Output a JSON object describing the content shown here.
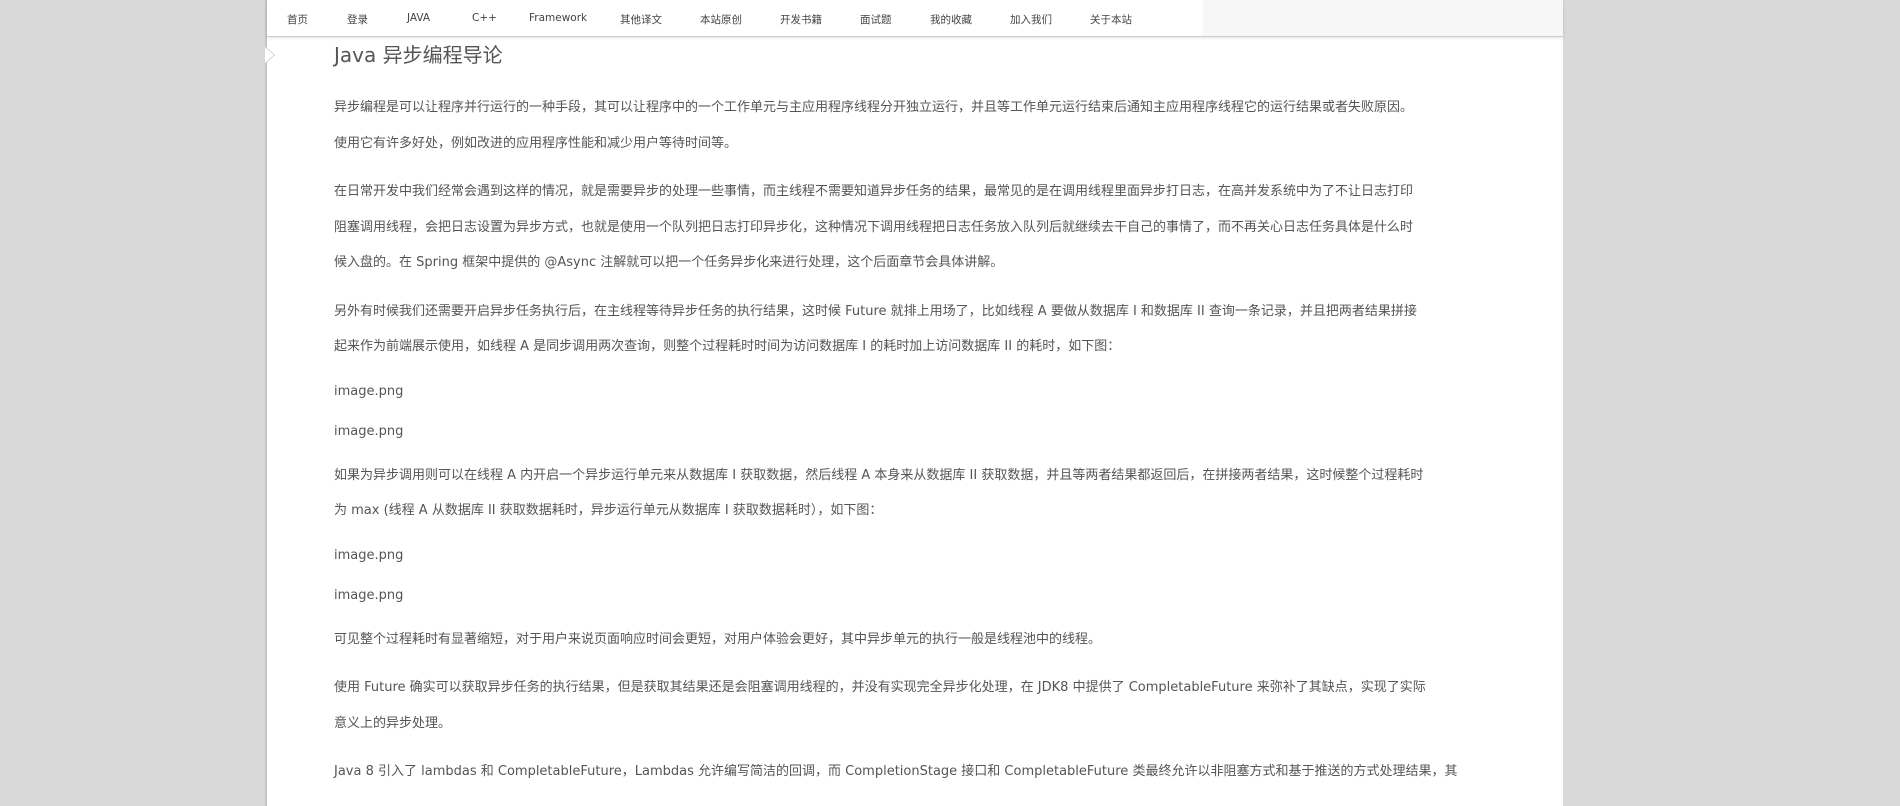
{
  "nav": {
    "items": [
      {
        "label": "首页"
      },
      {
        "label": "登录"
      },
      {
        "label": "JAVA"
      },
      {
        "label": "C++"
      },
      {
        "label": "Framework"
      },
      {
        "label": "其他译文"
      },
      {
        "label": "本站原创"
      },
      {
        "label": "开发书籍"
      },
      {
        "label": "面试题"
      },
      {
        "label": "我的收藏"
      },
      {
        "label": "加入我们"
      },
      {
        "label": "关于本站"
      }
    ]
  },
  "article": {
    "title": "Java 异步编程导论",
    "p1": [
      "异步编程是可以让程序并行运行的一种手段，其可以让程序中的一个工作单元与主应用程序线程分开独立运行，并且等工作单元运行结束后通知主应用程序线程它的运行结果或者失败原因。",
      "使用它有许多好处，例如改进的应用程序性能和减少用户等待时间等。"
    ],
    "p2": [
      "在日常开发中我们经常会遇到这样的情况，就是需要异步的处理一些事情，而主线程不需要知道异步任务的结果，最常见的是在调用线程里面异步打日志，在高并发系统中为了不让日志打印",
      "阻塞调用线程，会把日志设置为异步方式，也就是使用一个队列把日志打印异步化，这种情况下调用线程把日志任务放入队列后就继续去干自己的事情了，而不再关心日志任务具体是什么时",
      "候入盘的。在 Spring 框架中提供的 @Async 注解就可以把一个任务异步化来进行处理，这个后面章节会具体讲解。"
    ],
    "p3": [
      "另外有时候我们还需要开启异步任务执行后，在主线程等待异步任务的执行结果，这时候 Future 就排上用场了，比如线程 A 要做从数据库 I 和数据库 II 查询一条记录，并且把两者结果拼接",
      "起来作为前端展示使用，如线程 A 是同步调用两次查询，则整个过程耗时时间为访问数据库 I 的耗时加上访问数据库 II 的耗时，如下图："
    ],
    "img1": "image.png",
    "img2": "image.png",
    "p4": [
      "如果为异步调用则可以在线程 A 内开启一个异步运行单元来从数据库 I 获取数据，然后线程 A 本身来从数据库 II 获取数据，并且等两者结果都返回后，在拼接两者结果，这时候整个过程耗时",
      "为 max (线程 A 从数据库 II 获取数据耗时，异步运行单元从数据库 I 获取数据耗时），如下图："
    ],
    "img3": "image.png",
    "img4": "image.png",
    "p5": [
      "可见整个过程耗时有显著缩短，对于用户来说页面响应时间会更短，对用户体验会更好，其中异步单元的执行一般是线程池中的线程。"
    ],
    "p6": [
      "使用 Future 确实可以获取异步任务的执行结果，但是获取其结果还是会阻塞调用线程的，并没有实现完全异步化处理，在 JDK8 中提供了 CompletableFuture 来弥补了其缺点，实现了实际",
      "意义上的异步处理。"
    ],
    "p7": [
      "Java 8 引入了 lambdas 和 CompletableFuture，Lambdas 允许编写简洁的回调，而 CompletionStage 接口和 CompletableFuture 类最终允许以非阻塞方式和基于推送的方式处理结果，其"
    ]
  }
}
